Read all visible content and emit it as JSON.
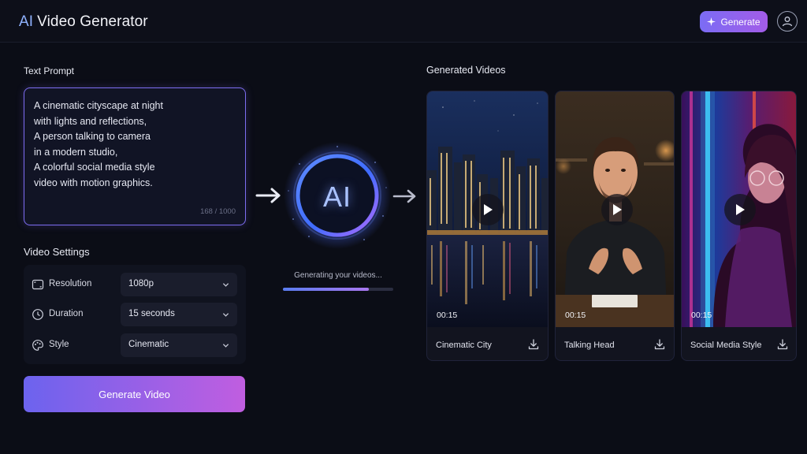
{
  "app": {
    "title_prefix": "AI",
    "title_rest": "Video Generator"
  },
  "header": {
    "generate_label": "Generate",
    "sparkle_icon": "sparkle-icon",
    "user_icon": "user-icon"
  },
  "prompt": {
    "label": "Text Prompt",
    "text": "A cinematic cityscape at night\nwith lights and reflections,\nA person talking to camera\nin a modern studio,\nA colorful social media style\nvideo with motion graphics.",
    "counter": "168 / 1000"
  },
  "settings": {
    "label": "Video Settings",
    "rows": [
      {
        "label": "Resolution",
        "value": "1080p",
        "icon": "resolution-icon"
      },
      {
        "label": "Duration",
        "value": "15 seconds",
        "icon": "clock-icon"
      },
      {
        "label": "Style",
        "value": "Cinematic",
        "icon": "palette-icon"
      }
    ]
  },
  "generate_video_label": "Generate Video",
  "processing": {
    "orb_label": "AI",
    "status": "Generating your videos...",
    "progress": 0.78
  },
  "videos": {
    "label": "Generated Videos",
    "items": [
      {
        "title": "Cinematic City",
        "duration": "00:15"
      },
      {
        "title": "Talking Head",
        "duration": "00:15"
      },
      {
        "title": "Social Media Style",
        "duration": "00:15"
      }
    ]
  },
  "colors": {
    "accent_start": "#6c63ee",
    "accent_end": "#c05ee0",
    "background": "#0b0d16",
    "orb_glow": "#5b7cff"
  }
}
